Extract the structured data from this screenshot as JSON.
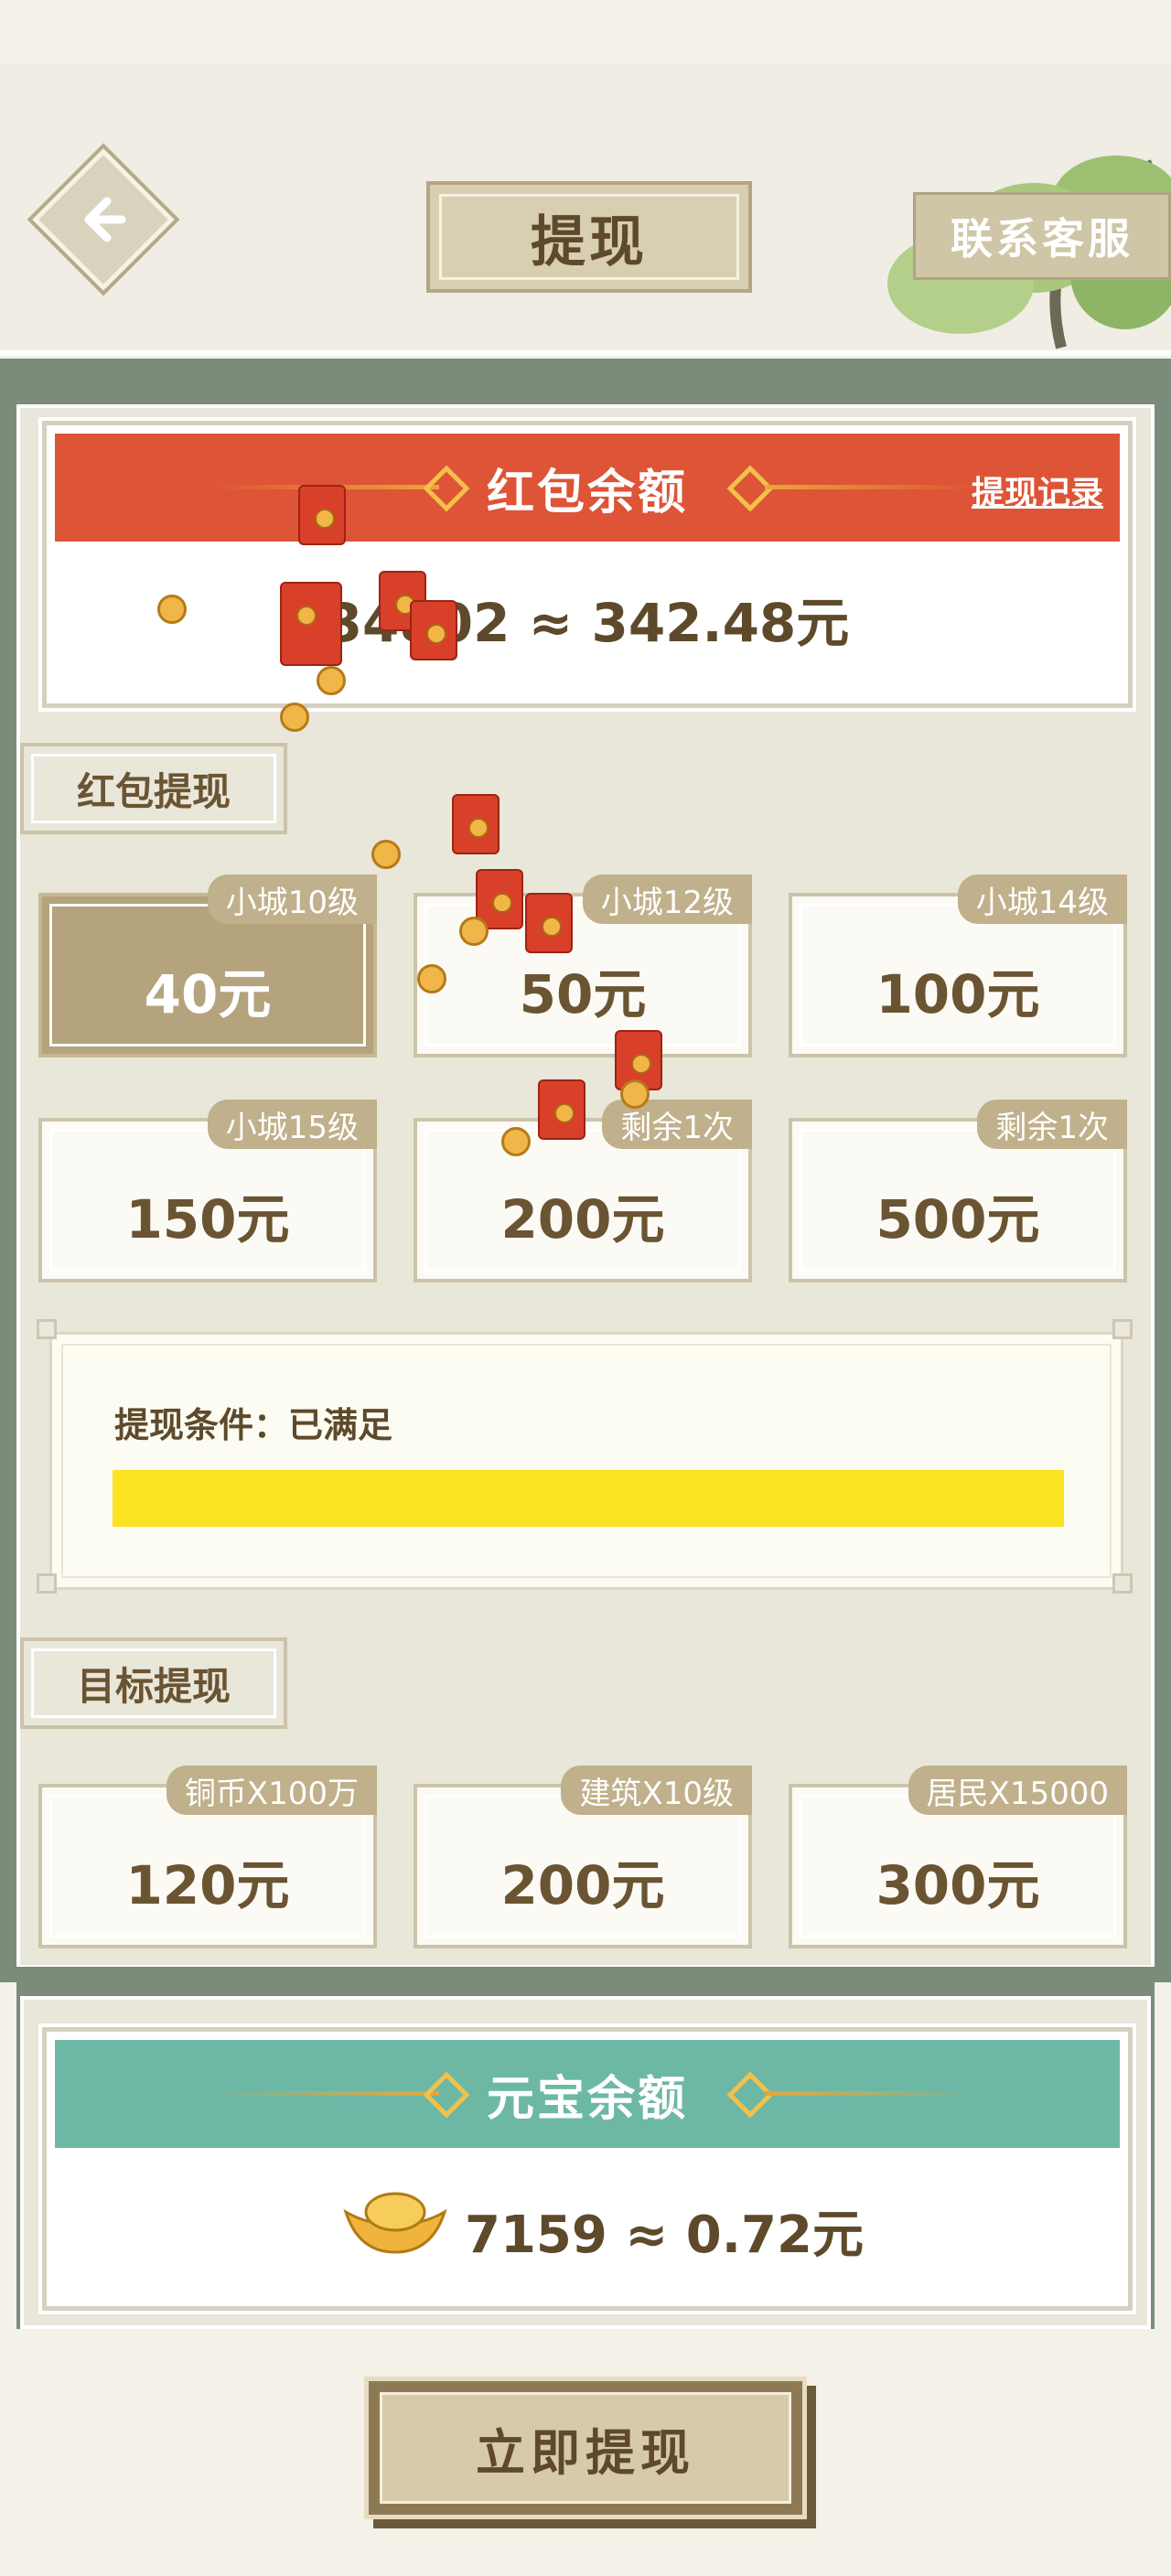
{
  "header": {
    "title": "提现",
    "contact_label": "联系客服"
  },
  "red_packet": {
    "title": "红包余额",
    "record_link": "提现记录",
    "balance": "34802 ≈ 342.48元"
  },
  "red_packet_withdraw": {
    "section_label": "红包提现",
    "options": [
      {
        "badge": "小城10级",
        "amount": "40元",
        "selected": true
      },
      {
        "badge": "小城12级",
        "amount": "50元",
        "selected": false
      },
      {
        "badge": "小城14级",
        "amount": "100元",
        "selected": false
      },
      {
        "badge": "小城15级",
        "amount": "150元",
        "selected": false
      },
      {
        "badge": "剩余1次",
        "amount": "200元",
        "selected": false
      },
      {
        "badge": "剩余1次",
        "amount": "500元",
        "selected": false
      }
    ]
  },
  "condition": {
    "label": "提现条件：已满足",
    "progress": 1.0,
    "bar_color": "#fbe322"
  },
  "target_withdraw": {
    "section_label": "目标提现",
    "options": [
      {
        "badge": "铜币X100万",
        "amount": "120元"
      },
      {
        "badge": "建筑X10级",
        "amount": "200元"
      },
      {
        "badge": "居民X15000",
        "amount": "300元"
      }
    ]
  },
  "yuanbao": {
    "title": "元宝余额",
    "balance": "7159 ≈ 0.72元",
    "icon": "gold-ingot-icon"
  },
  "cta": {
    "label": "立即提现"
  },
  "colors": {
    "red_header": "#de5436",
    "teal_header": "#6cb8a5",
    "selected_option": "#b5a37e",
    "frame": "#7b8c7b"
  }
}
